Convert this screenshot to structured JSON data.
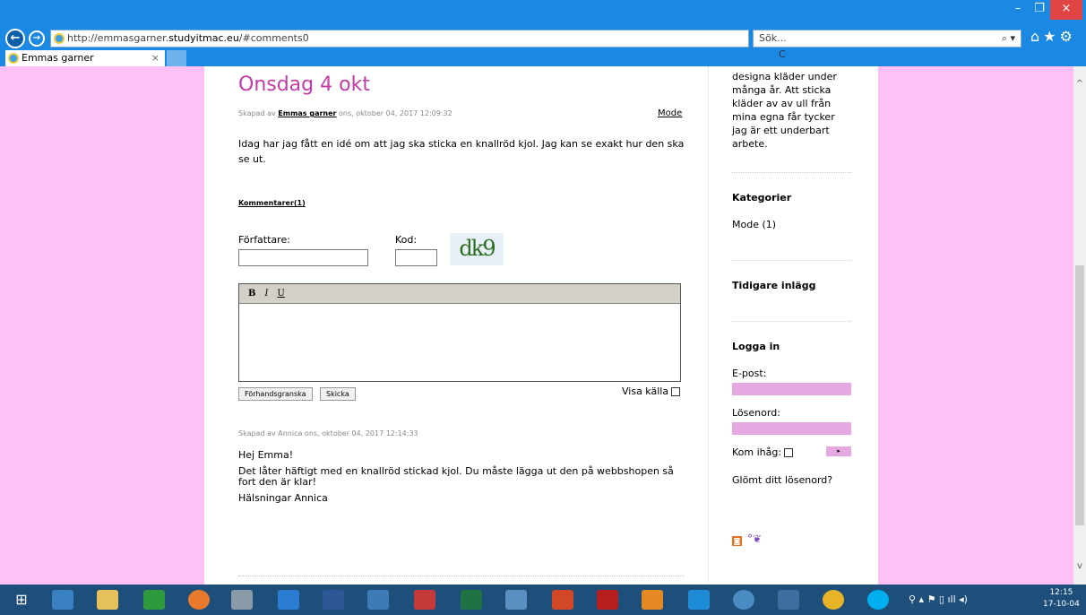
{
  "browser": {
    "url_prefix": "http://emmasgarner.",
    "url_host": "studyitmac.eu",
    "url_suffix": "/#comments0",
    "search_placeholder": "Sök...",
    "tab_title": "Emmas garner",
    "tab_close": "×",
    "window_min": "–",
    "window_max": "❐",
    "window_close": "×",
    "refresh": "▾ C",
    "search_icon": "⌕ ▾",
    "toolbar_icons": "⌂★⚙"
  },
  "post": {
    "title": "Onsdag 4 okt",
    "meta_prefix": "Skapad av ",
    "author": "Emmas garner",
    "meta_date": " ons, oktober 04, 2017 12:09:32",
    "category_link": "Mode",
    "body": "Idag har jag fått en idé om att jag ska sticka en knallröd kjol. Jag kan se exakt hur den ska se ut.",
    "comments_link": "Kommentarer(1)"
  },
  "comment_form": {
    "author_label": "Författare:",
    "code_label": "Kod:",
    "captcha_text": "dk9",
    "bold": "B",
    "italic": "I",
    "underline": "U",
    "preview_button": "Förhandsgranska",
    "send_button": "Skicka",
    "show_source": "Visa källa"
  },
  "comment": {
    "meta": "Skapad av Annica ons, oktober 04, 2017 12:14:33",
    "greeting": "Hej Emma!",
    "body": "Det låter häftigt med en knallröd stickad kjol. Du måste lägga ut den på webbshopen så fort den är klar!",
    "signoff": "Hälsningar Annica"
  },
  "sidebar": {
    "intro": "designa kläder under många år. Att sticka kläder av av ull från mina egna får tycker jag är ett underbart arbete.",
    "categories_heading": "Kategorier",
    "category_item": "Mode (1)",
    "earlier_heading": "Tidigare inlägg",
    "login_heading": "Logga in",
    "email_label": "E-post:",
    "password_label": "Lösenord:",
    "remember_label": "Kom ihåg:",
    "forgot_link": "Glömt ditt lösenord?",
    "login_arrow": "▸"
  },
  "taskbar": {
    "clock_time": "12:15",
    "clock_date": "17-10-04",
    "tray_text": "⚲ ▴ ⚑ ▯ ıll ◂)"
  },
  "icons": {
    "back": "←",
    "forward": "→",
    "rss": "◙",
    "atom": "°❦",
    "scroll_up": "^",
    "scroll_down": "v"
  }
}
